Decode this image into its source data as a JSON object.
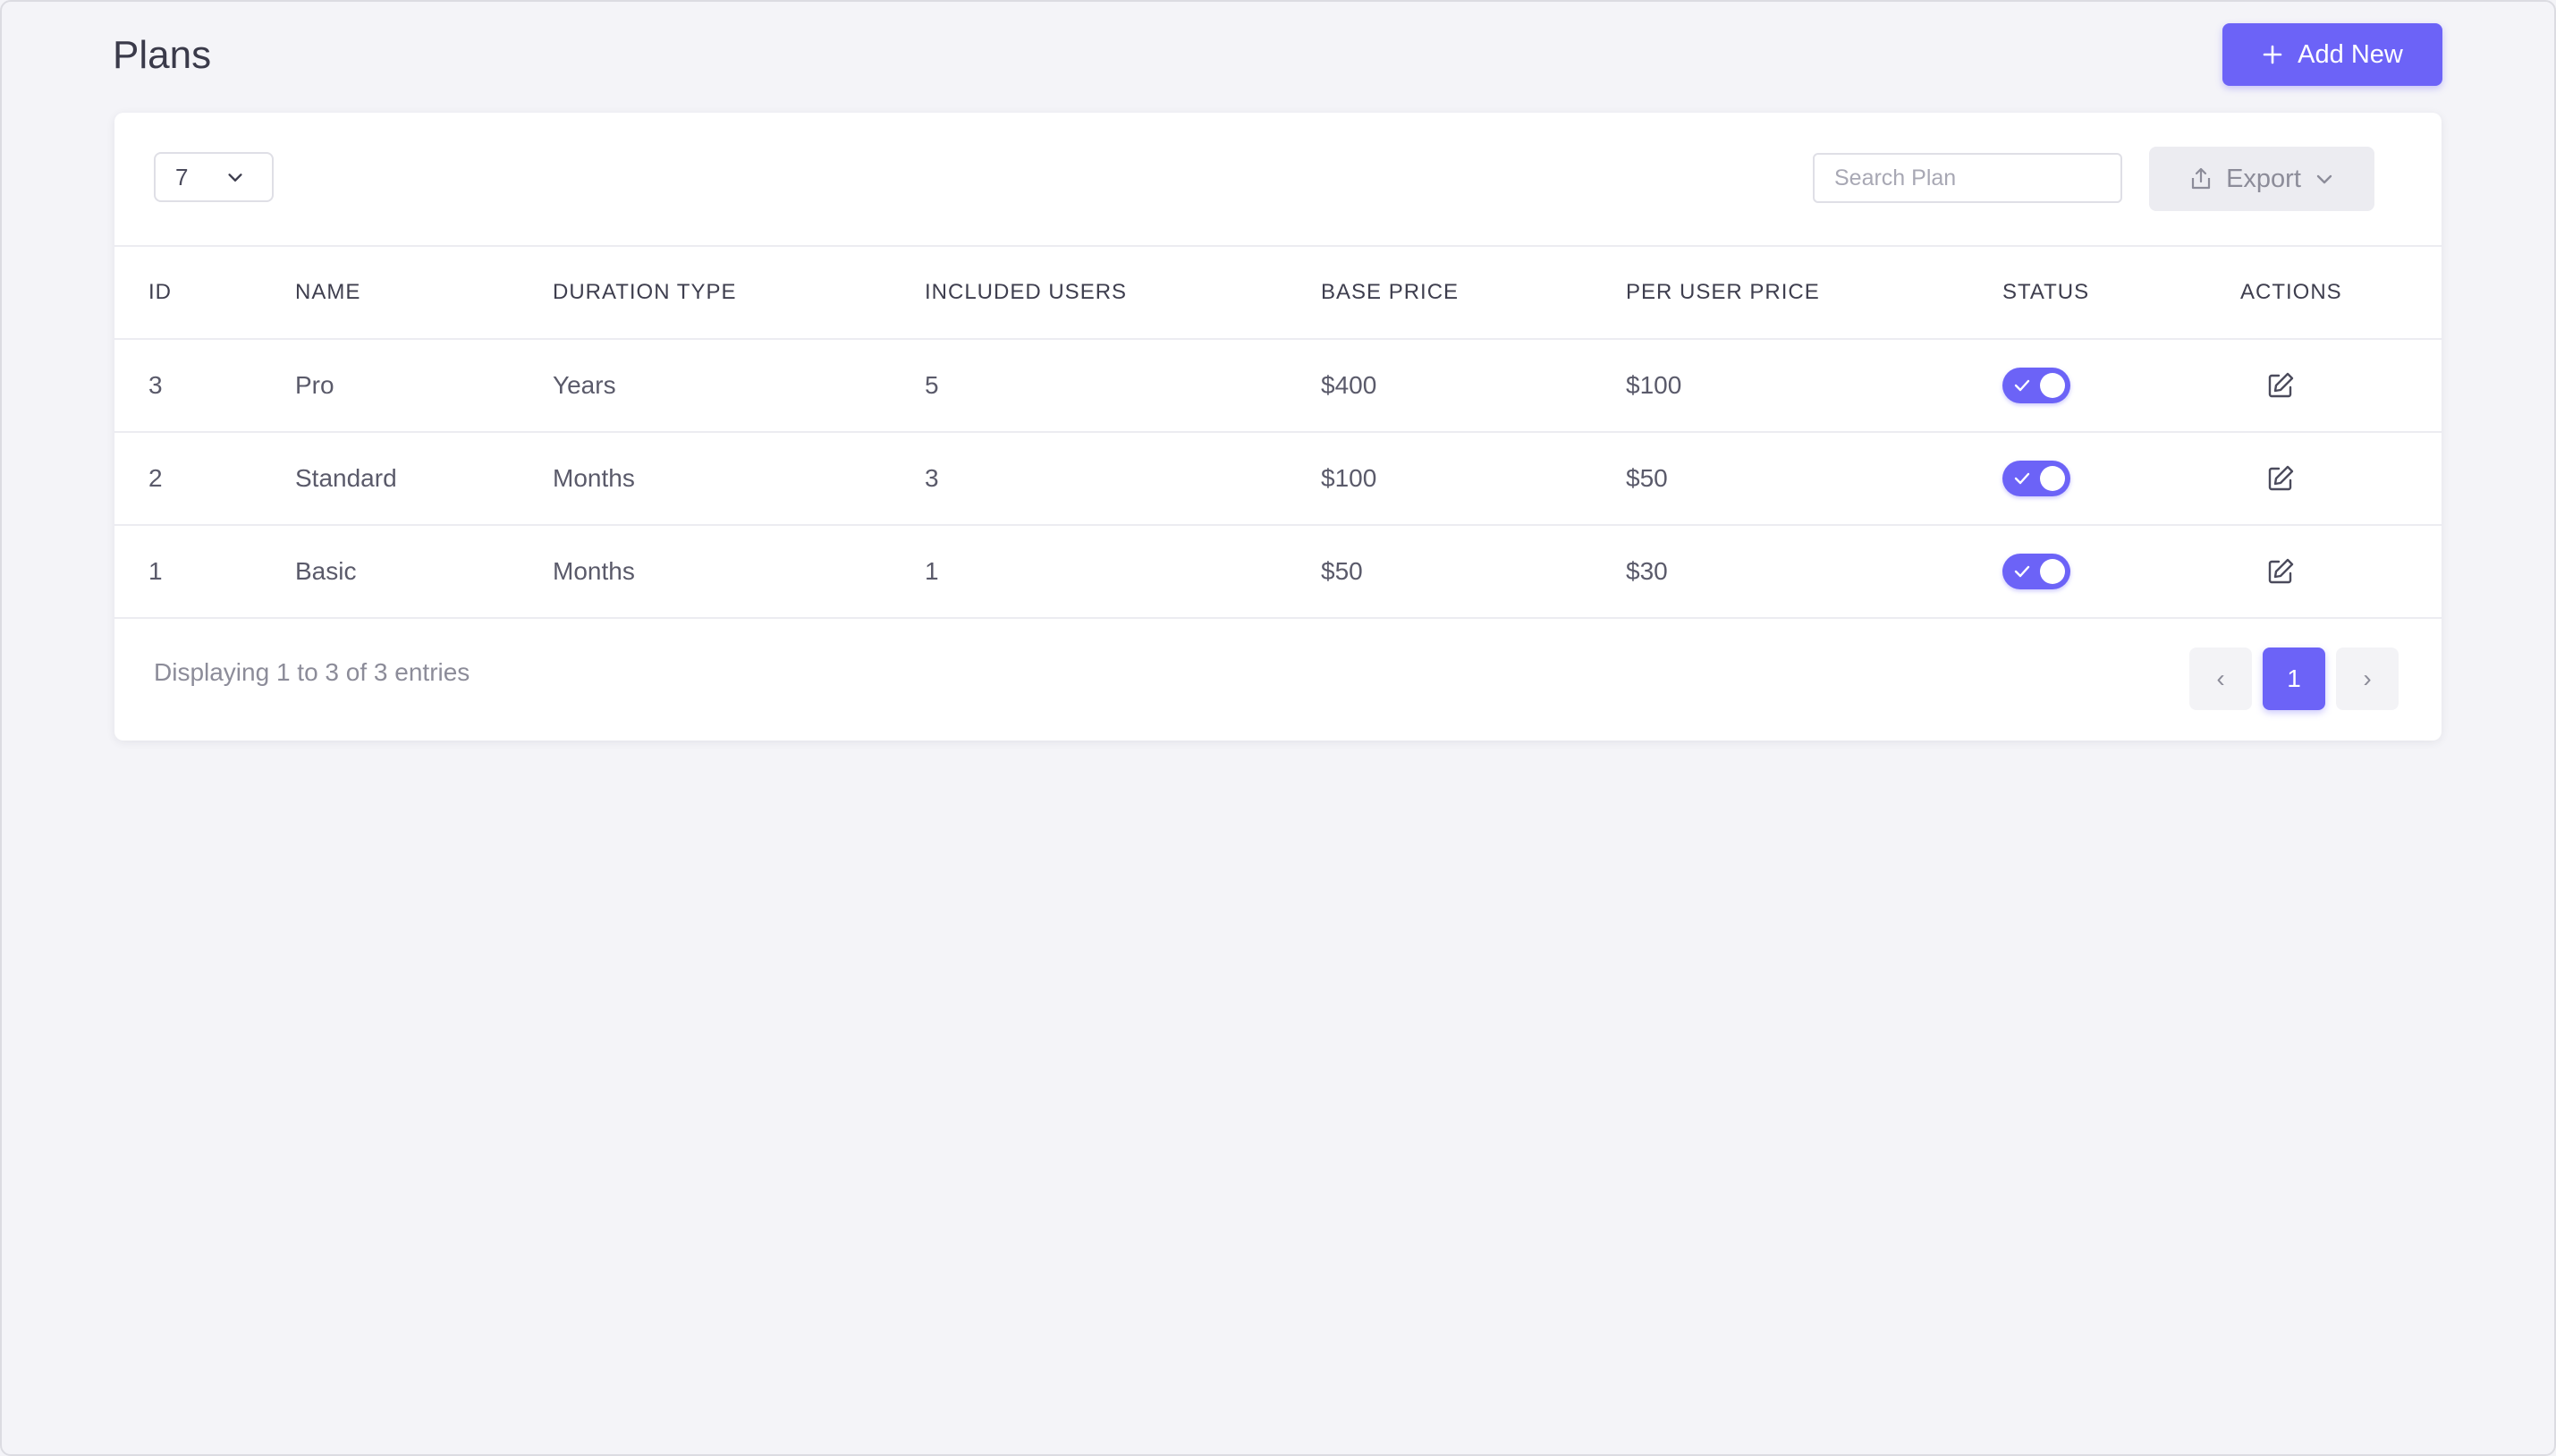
{
  "header": {
    "title": "Plans",
    "add_button_label": "Add New"
  },
  "toolbar": {
    "page_size_value": "7",
    "search_placeholder": "Search Plan",
    "export_label": "Export"
  },
  "table": {
    "columns": [
      "ID",
      "NAME",
      "DURATION TYPE",
      "INCLUDED USERS",
      "BASE PRICE",
      "PER USER PRICE",
      "STATUS",
      "ACTIONS"
    ],
    "rows": [
      {
        "id": "3",
        "name": "Pro",
        "duration_type": "Years",
        "included_users": "5",
        "base_price": "$400",
        "per_user_price": "$100",
        "status_on": true
      },
      {
        "id": "2",
        "name": "Standard",
        "duration_type": "Months",
        "included_users": "3",
        "base_price": "$100",
        "per_user_price": "$50",
        "status_on": true
      },
      {
        "id": "1",
        "name": "Basic",
        "duration_type": "Months",
        "included_users": "1",
        "base_price": "$50",
        "per_user_price": "$30",
        "status_on": true
      }
    ]
  },
  "footer": {
    "summary": "Displaying 1 to 3 of 3 entries",
    "pagination": {
      "prev_glyph": "‹",
      "current_page": "1",
      "next_glyph": "›"
    }
  },
  "icons": {
    "add": "plus-icon",
    "page_size_dropdown": "chevron-down-icon",
    "export": "upload-icon",
    "export_dropdown": "chevron-down-icon",
    "status": "check-icon",
    "action": "edit-icon"
  },
  "colors": {
    "accent": "#6c63f7",
    "background": "#f4f4f8",
    "card": "#ffffff"
  }
}
